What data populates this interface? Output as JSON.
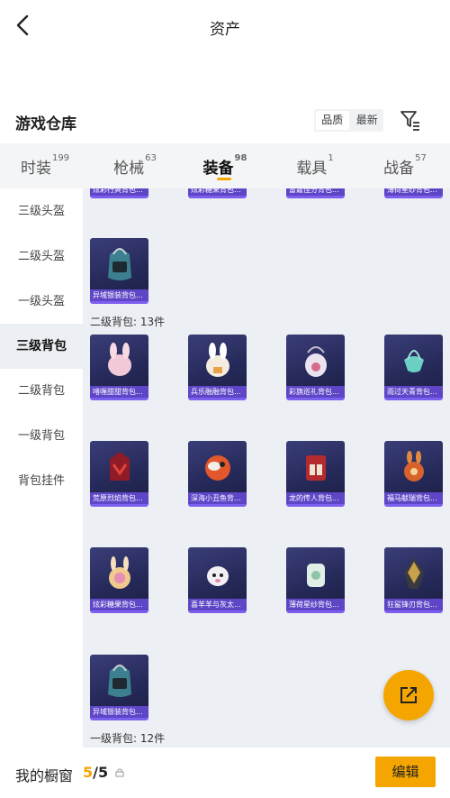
{
  "nav": {
    "title": "资产"
  },
  "warehouse": {
    "title": "游戏仓库",
    "sort_quality": "品质",
    "sort_newest": "最新"
  },
  "tabs": [
    {
      "label": "时装",
      "count": "199"
    },
    {
      "label": "枪械",
      "count": "63"
    },
    {
      "label": "装备",
      "count": "98"
    },
    {
      "label": "载具",
      "count": "1"
    },
    {
      "label": "战备",
      "count": "57"
    }
  ],
  "sidebar": [
    {
      "label": "三级头盔"
    },
    {
      "label": "二级头盔"
    },
    {
      "label": "一级头盔"
    },
    {
      "label": "三级背包"
    },
    {
      "label": "二级背包"
    },
    {
      "label": "一级背包"
    },
    {
      "label": "背包挂件"
    }
  ],
  "top_partial": [
    "炫彩行爽背包...",
    "炫彩糖果背包...",
    "雷霆佳分背包...",
    "薄荷星纱背包..."
  ],
  "level3_last": {
    "name": "异域银装背包..."
  },
  "level2": {
    "title": "二级背包: 13件",
    "items": [
      {
        "name": "啫喱甜甜背包..."
      },
      {
        "name": "兵乐融融背包..."
      },
      {
        "name": "彩旗巡礼背包..."
      },
      {
        "name": "雨过天青背包..."
      },
      {
        "name": "荒原烈焰背包..."
      },
      {
        "name": "深海小丑鱼背..."
      },
      {
        "name": "龙的传人背包..."
      },
      {
        "name": "福马献瑞背包..."
      },
      {
        "name": "炫彩糖果背包..."
      },
      {
        "name": "喜羊羊与灰太..."
      },
      {
        "name": "薄荷星纱背包..."
      },
      {
        "name": "狂鲨锋刃背包..."
      },
      {
        "name": "异域银装背包..."
      }
    ]
  },
  "level1": {
    "title": "一级背包: 12件"
  },
  "bottom": {
    "showcase_label": "我的橱窗",
    "count_current": "5",
    "count_total": "/5",
    "edit_label": "编辑"
  },
  "colors": {
    "accent": "#f5a500",
    "card_border": "#7d5ff0"
  }
}
